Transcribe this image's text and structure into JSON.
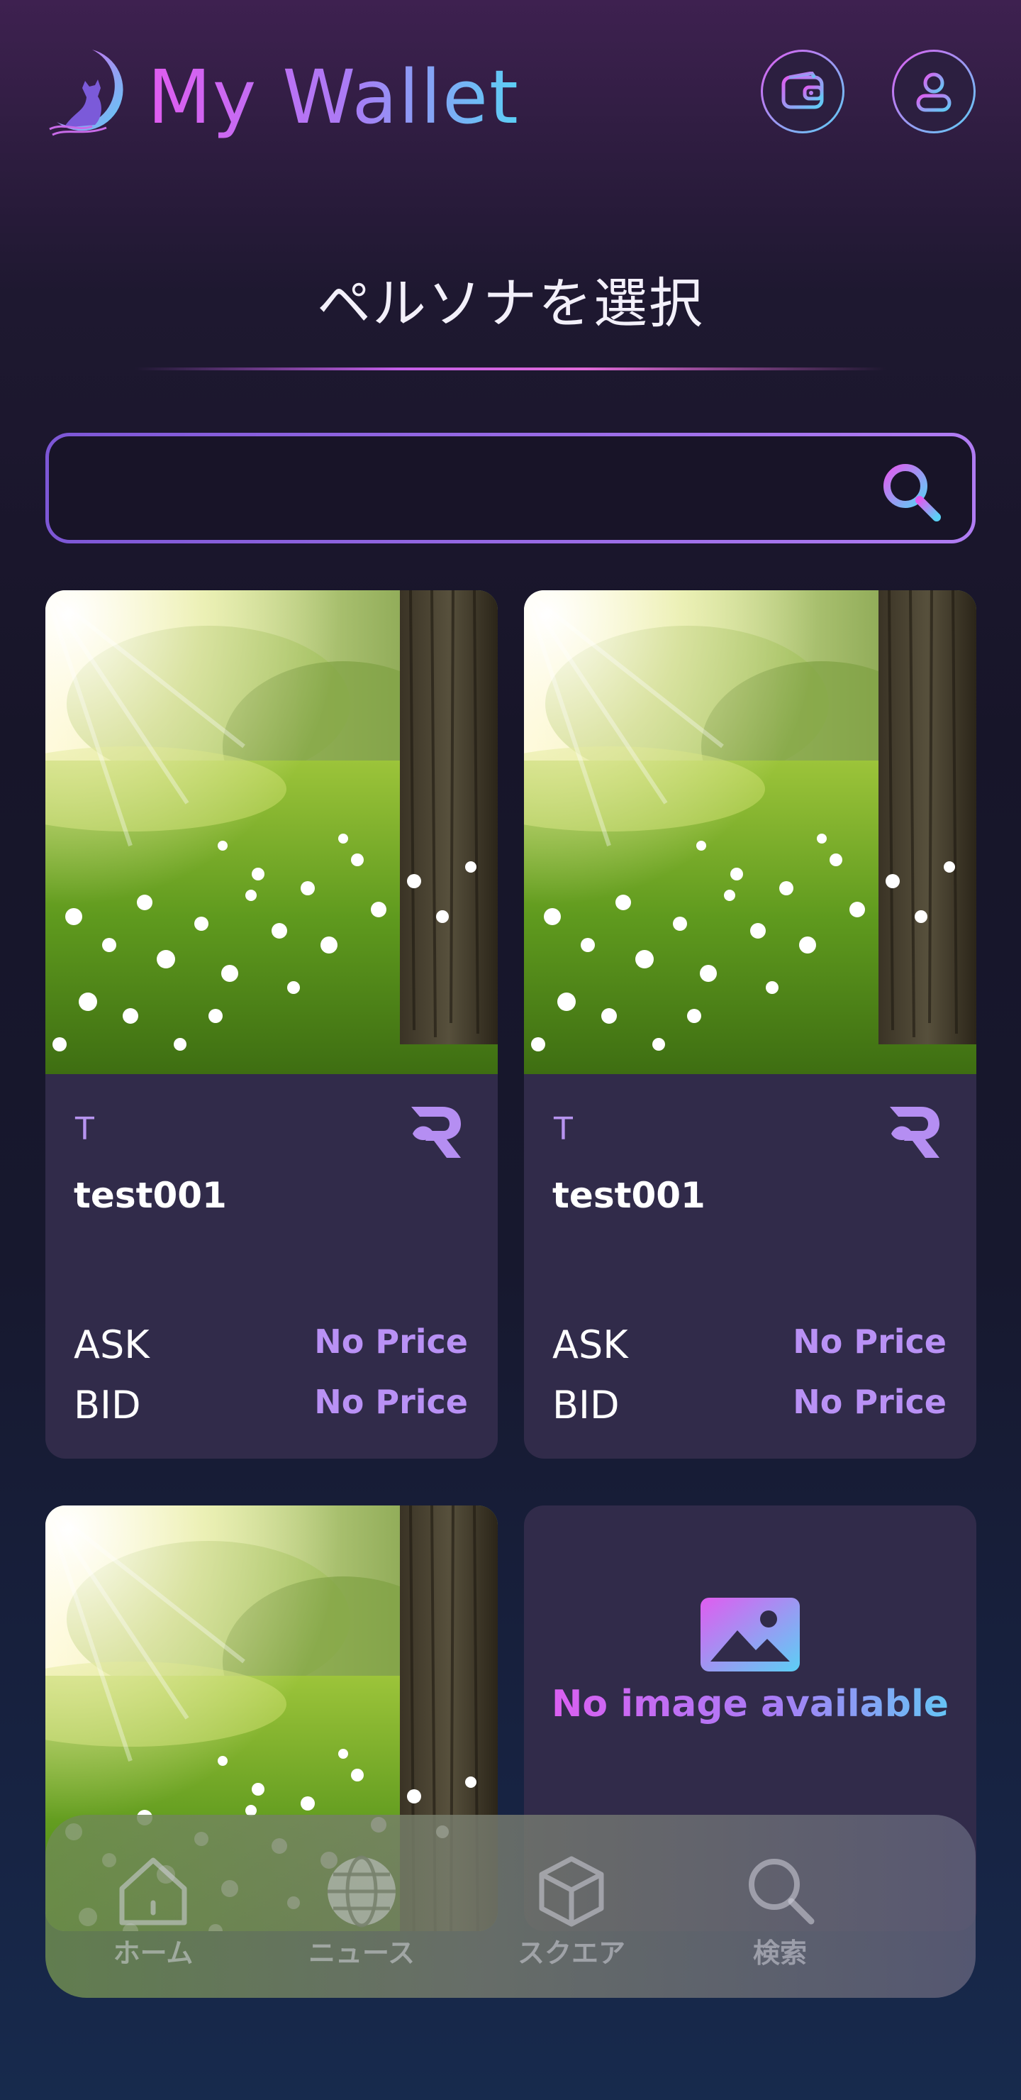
{
  "header": {
    "app_title": "My Wallet"
  },
  "page": {
    "title": "ペルソナを選択"
  },
  "search": {
    "value": "",
    "placeholder": ""
  },
  "cards": [
    {
      "symbol": "T",
      "name": "test001",
      "ask_label": "ASK",
      "ask_value": "No Price",
      "bid_label": "BID",
      "bid_value": "No Price"
    },
    {
      "symbol": "T",
      "name": "test001",
      "ask_label": "ASK",
      "ask_value": "No Price",
      "bid_label": "BID",
      "bid_value": "No Price"
    }
  ],
  "no_image": {
    "text": "No image available"
  },
  "nav": {
    "items": [
      {
        "label": "ホーム",
        "icon": "home-icon"
      },
      {
        "label": "ニュース",
        "icon": "globe-icon"
      },
      {
        "label": "スクエア",
        "icon": "cube-icon"
      },
      {
        "label": "検索",
        "icon": "search-icon"
      }
    ]
  },
  "colors": {
    "accent_pink": "#e05cf0",
    "accent_purple": "#a97cf5",
    "accent_cyan": "#5bd0f5",
    "card_bg": "#312b4a",
    "price_text": "#b991f5"
  }
}
